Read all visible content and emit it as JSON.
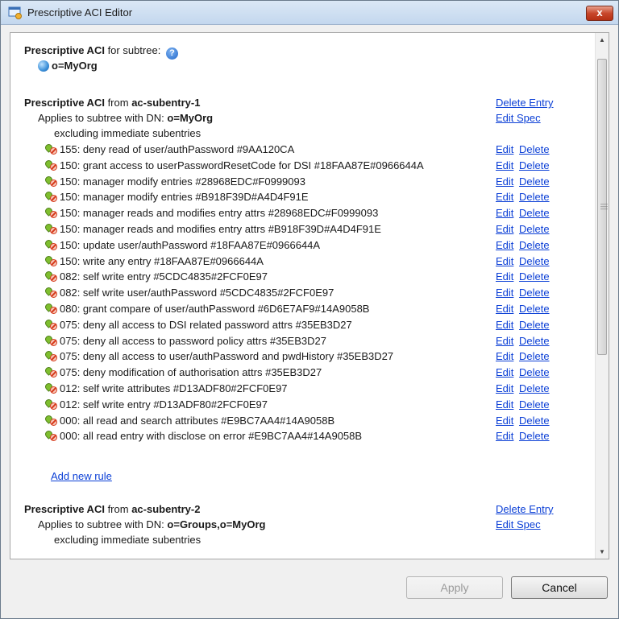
{
  "window": {
    "title": "Prescriptive ACI Editor",
    "close_label": "x"
  },
  "header": {
    "prefix": "Prescriptive ACI",
    "suffix": " for subtree: ",
    "help_glyph": "?",
    "subtree": "o=MyOrg"
  },
  "sections": [
    {
      "title_prefix": "Prescriptive ACI",
      "title_mid": " from ",
      "title_name": "ac-subentry-1",
      "delete_entry": "Delete Entry",
      "edit_spec": "Edit Spec",
      "applies_prefix": "Applies to subtree with DN: ",
      "applies_dn": "o=MyOrg",
      "excluding": "excluding immediate subentries",
      "add_rule": "Add new rule",
      "rules": [
        "155: deny read of user/authPassword #9AA120CA",
        "150: grant access to userPasswordResetCode for DSI #18FAA87E#0966644A",
        "150: manager modify entries #28968EDC#F0999093",
        "150: manager modify entries #B918F39D#A4D4F91E",
        "150: manager reads and modifies entry attrs #28968EDC#F0999093",
        "150: manager reads and modifies entry attrs #B918F39D#A4D4F91E",
        "150: update user/authPassword #18FAA87E#0966644A",
        "150: write any entry #18FAA87E#0966644A",
        "082: self write entry #5CDC4835#2FCF0E97",
        "082: self write user/authPassword #5CDC4835#2FCF0E97",
        "080: grant compare of user/authPassword #6D6E7AF9#14A9058B",
        "075: deny all access to DSI related password attrs #35EB3D27",
        "075: deny all access to password policy attrs #35EB3D27",
        "075: deny all access to user/authPassword and pwdHistory #35EB3D27",
        "075: deny modification of authorisation attrs #35EB3D27",
        "012: self write attributes #D13ADF80#2FCF0E97",
        "012: self write entry #D13ADF80#2FCF0E97",
        "000: all read and search attributes #E9BC7AA4#14A9058B",
        "000: all read entry with disclose on error #E9BC7AA4#14A9058B"
      ]
    },
    {
      "title_prefix": "Prescriptive ACI",
      "title_mid": " from ",
      "title_name": "ac-subentry-2",
      "delete_entry": "Delete Entry",
      "edit_spec": "Edit Spec",
      "applies_prefix": "Applies to subtree with DN: ",
      "applies_dn": "o=Groups,o=MyOrg",
      "excluding": "excluding immediate subentries"
    }
  ],
  "row_actions": {
    "edit": "Edit",
    "delete": "Delete"
  },
  "buttons": {
    "apply": "Apply",
    "cancel": "Cancel"
  },
  "colors": {
    "link": "#0b3fd6",
    "close": "#c8472c"
  }
}
